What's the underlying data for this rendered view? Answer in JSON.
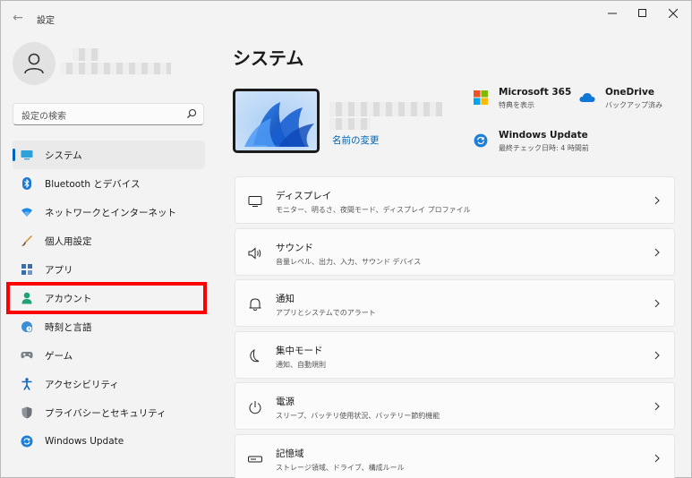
{
  "window": {
    "title": "設定"
  },
  "search": {
    "placeholder": "設定の検索"
  },
  "sidebar": {
    "items": [
      {
        "label": "システム"
      },
      {
        "label": "Bluetooth とデバイス"
      },
      {
        "label": "ネットワークとインターネット"
      },
      {
        "label": "個人用設定"
      },
      {
        "label": "アプリ"
      },
      {
        "label": "アカウント"
      },
      {
        "label": "時刻と言語"
      },
      {
        "label": "ゲーム"
      },
      {
        "label": "アクセシビリティ"
      },
      {
        "label": "プライバシーとセキュリティ"
      },
      {
        "label": "Windows Update"
      }
    ]
  },
  "main": {
    "title": "システム",
    "rename_label": "名前の変更",
    "tiles": [
      {
        "title": "Microsoft 365",
        "sub": "特典を表示"
      },
      {
        "title": "OneDrive",
        "sub": "バックアップ済み"
      },
      {
        "title": "Windows Update",
        "sub": "最終チェック日時: 4 時間前"
      }
    ],
    "settings": [
      {
        "title": "ディスプレイ",
        "sub": "モニター、明るさ、夜間モード、ディスプレイ プロファイル"
      },
      {
        "title": "サウンド",
        "sub": "音量レベル、出力、入力、サウンド デバイス"
      },
      {
        "title": "通知",
        "sub": "アプリとシステムでのアラート"
      },
      {
        "title": "集中モード",
        "sub": "通知、自動規則"
      },
      {
        "title": "電源",
        "sub": "スリープ、バッテリ使用状況、バッテリー節約機能"
      },
      {
        "title": "記憶域",
        "sub": "ストレージ領域、ドライブ、構成ルール"
      }
    ]
  },
  "colors": {
    "accent": "#0067c0",
    "highlight": "#ff0000",
    "background": "#f3f3f3"
  }
}
